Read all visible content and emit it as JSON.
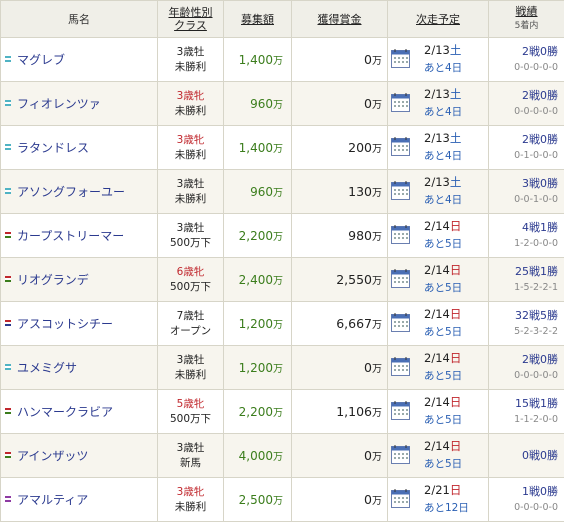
{
  "header": {
    "name": "馬名",
    "class_top": "年齢性別",
    "class_bottom": "クラス",
    "prize": "募集額",
    "earnings": "獲得賞金",
    "next": "次走予定",
    "record": "戦績",
    "record_sub": "5着内"
  },
  "rows": [
    {
      "mark_colors": [
        "#4fb3c4"
      ],
      "name": "マグレブ",
      "age": "3歳牡",
      "age_color": "#222",
      "cls": "未勝利",
      "prize": "1,400",
      "prize_unit": "万",
      "earn": "0",
      "earn_unit": "万",
      "date": "2/13",
      "dow": "土",
      "dow_type": "sat",
      "until": "あと4日",
      "record": "2戦0勝",
      "detail": "0-0-0-0-0"
    },
    {
      "mark_colors": [
        "#4fb3c4"
      ],
      "name": "フィオレンツァ",
      "age": "3歳牝",
      "age_color": "#c0272d",
      "cls": "未勝利",
      "prize": "960",
      "prize_unit": "万",
      "earn": "0",
      "earn_unit": "万",
      "date": "2/13",
      "dow": "土",
      "dow_type": "sat",
      "until": "あと4日",
      "record": "2戦0勝",
      "detail": "0-0-0-0-0"
    },
    {
      "mark_colors": [
        "#4fb3c4"
      ],
      "name": "ラタンドレス",
      "age": "3歳牝",
      "age_color": "#c0272d",
      "cls": "未勝利",
      "prize": "1,400",
      "prize_unit": "万",
      "earn": "200",
      "earn_unit": "万",
      "date": "2/13",
      "dow": "土",
      "dow_type": "sat",
      "until": "あと4日",
      "record": "2戦0勝",
      "detail": "0-1-0-0-0"
    },
    {
      "mark_colors": [
        "#4fb3c4"
      ],
      "name": "アソングフォーユー",
      "age": "3歳牡",
      "age_color": "#222",
      "cls": "未勝利",
      "prize": "960",
      "prize_unit": "万",
      "earn": "130",
      "earn_unit": "万",
      "date": "2/13",
      "dow": "土",
      "dow_type": "sat",
      "until": "あと4日",
      "record": "3戦0勝",
      "detail": "0-0-1-0-0"
    },
    {
      "mark_colors": [
        "#c0272d",
        "#3b7d1c"
      ],
      "name": "カープストリーマー",
      "age": "3歳牡",
      "age_color": "#222",
      "cls": "500万下",
      "prize": "2,200",
      "prize_unit": "万",
      "earn": "980",
      "earn_unit": "万",
      "date": "2/14",
      "dow": "日",
      "dow_type": "sun",
      "until": "あと5日",
      "record": "4戦1勝",
      "detail": "1-2-0-0-0"
    },
    {
      "mark_colors": [
        "#c0272d",
        "#3b7d1c"
      ],
      "name": "リオグランデ",
      "age": "6歳牝",
      "age_color": "#c0272d",
      "cls": "500万下",
      "prize": "2,400",
      "prize_unit": "万",
      "earn": "2,550",
      "earn_unit": "万",
      "date": "2/14",
      "dow": "日",
      "dow_type": "sun",
      "until": "あと5日",
      "record": "25戦1勝",
      "detail": "1-5-2-2-1"
    },
    {
      "mark_colors": [
        "#c0272d",
        "#2b3a8f"
      ],
      "name": "アスコットシチー",
      "age": "7歳牡",
      "age_color": "#222",
      "cls": "オープン",
      "prize": "1,200",
      "prize_unit": "万",
      "earn": "6,667",
      "earn_unit": "万",
      "date": "2/14",
      "dow": "日",
      "dow_type": "sun",
      "until": "あと5日",
      "record": "32戦5勝",
      "detail": "5-2-3-2-2"
    },
    {
      "mark_colors": [
        "#4fb3c4"
      ],
      "name": "ユメミグサ",
      "age": "3歳牡",
      "age_color": "#222",
      "cls": "未勝利",
      "prize": "1,200",
      "prize_unit": "万",
      "earn": "0",
      "earn_unit": "万",
      "date": "2/14",
      "dow": "日",
      "dow_type": "sun",
      "until": "あと5日",
      "record": "2戦0勝",
      "detail": "0-0-0-0-0"
    },
    {
      "mark_colors": [
        "#c0272d",
        "#3b7d1c"
      ],
      "name": "ハンマークラビア",
      "age": "5歳牝",
      "age_color": "#c0272d",
      "cls": "500万下",
      "prize": "2,200",
      "prize_unit": "万",
      "earn": "1,106",
      "earn_unit": "万",
      "date": "2/14",
      "dow": "日",
      "dow_type": "sun",
      "until": "あと5日",
      "record": "15戦1勝",
      "detail": "1-1-2-0-0"
    },
    {
      "mark_colors": [
        "#c0272d",
        "#3b7d1c"
      ],
      "name": "アインザッツ",
      "age": "3歳牡",
      "age_color": "#222",
      "cls": "新馬",
      "prize": "4,000",
      "prize_unit": "万",
      "earn": "0",
      "earn_unit": "万",
      "date": "2/14",
      "dow": "日",
      "dow_type": "sun",
      "until": "あと5日",
      "record": "0戦0勝",
      "detail": ""
    },
    {
      "mark_colors": [
        "#8e3aa3"
      ],
      "name": "アマルティア",
      "age": "3歳牝",
      "age_color": "#c0272d",
      "cls": "未勝利",
      "prize": "2,500",
      "prize_unit": "万",
      "earn": "0",
      "earn_unit": "万",
      "date": "2/21",
      "dow": "日",
      "dow_type": "sun",
      "until": "あと12日",
      "record": "1戦0勝",
      "detail": "0-0-0-0-0"
    }
  ]
}
